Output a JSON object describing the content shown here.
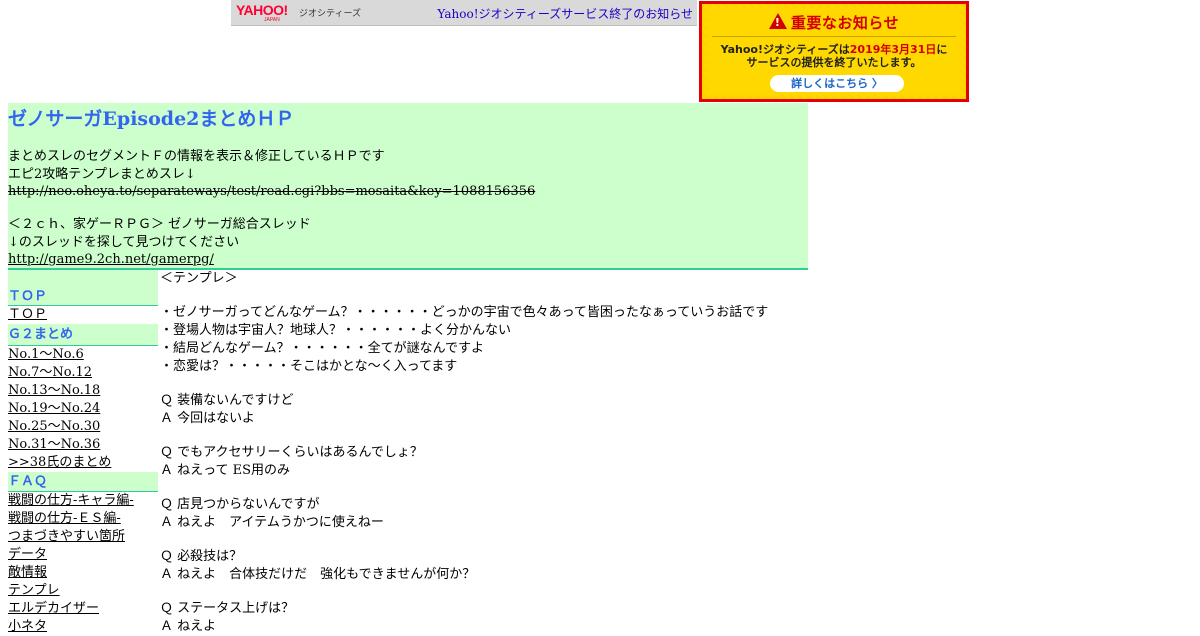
{
  "geo_bar": {
    "logo_text": "YAHOO!",
    "logo_sub": "JAPAN",
    "service_label": "ジオシティーズ",
    "notice_link": "Yahoo!ジオシティーズサービス終了のお知らせ"
  },
  "banner": {
    "title": "重要なお知らせ",
    "body_part1": "Yahoo!ジオシティーズは",
    "body_date": "2019年3月31日",
    "body_part2": "に",
    "body_line2": "サービスの提供を終了いたします。",
    "button_label": "詳しくはこちら 〉"
  },
  "header": {
    "title": "ゼノサーガEpisode2まとめＨＰ",
    "desc_line1": "まとめスレのセグメントＦの情報を表示＆修正しているＨＰです",
    "desc_line2": "エピ2攻略テンプレまとめスレ↓",
    "old_thread_url": "http://neo.oheya.to/separateways/test/read.cgi?bbs=mosaita&key=1088156356",
    "board_line1": "＜２ｃｈ、家ゲーＲＰＧ＞ ゼノサーガ総合スレッド",
    "board_line2": "↓のスレッドを探して見つけてください",
    "board_url": "http://game9.2ch.net/gamerpg/"
  },
  "sidebar": {
    "top_heading": "ＴＯＰ",
    "top_link": "ＴＯＰ",
    "g2_heading": "Ｇ２まとめ",
    "g2_links": [
      "No.1～No.6",
      "No.7～No.12",
      "No.13～No.18",
      "No.19～No.24",
      "No.25～No.30",
      "No.31～No.36",
      ">>38氏のまとめ"
    ],
    "faq_heading": "ＦＡＱ",
    "faq_links": [
      "戦闘の仕方-キャラ編-",
      "戦闘の仕方-ＥＳ編-",
      "つまづきやすい箇所",
      "データ",
      "敵情報",
      "テンプレ",
      "エルデカイザー",
      "小ネタ"
    ]
  },
  "main": {
    "heading": "＜テンプレ＞",
    "intro": [
      "・ゼノサーガってどんなゲーム？・・・・・・どっかの宇宙で色々あって皆困ったなぁっていうお話です",
      "・登場人物は宇宙人？地球人？・・・・・・よく分かんない",
      "・結局どんなゲーム？・・・・・・全てが謎なんですよ",
      "・恋愛は？・・・・・そこはかとな～く入ってます"
    ],
    "qa": [
      {
        "q": "Ｑ 装備ないんですけど",
        "a": "Ａ 今回はないよ"
      },
      {
        "q": "Ｑ でもアクセサリーくらいはあるんでしょ？",
        "a": "Ａ ねえって ES用のみ"
      },
      {
        "q": "Ｑ 店見つからないんですが",
        "a": "Ａ ねえよ　アイテムうかつに使えねー"
      },
      {
        "q": "Ｑ 必殺技は？",
        "a": "Ａ ねえよ　合体技だけだ　強化もできませんが何か？"
      },
      {
        "q": "Ｑ ステータス上げは？",
        "a": "Ａ ねえよ"
      }
    ]
  }
}
